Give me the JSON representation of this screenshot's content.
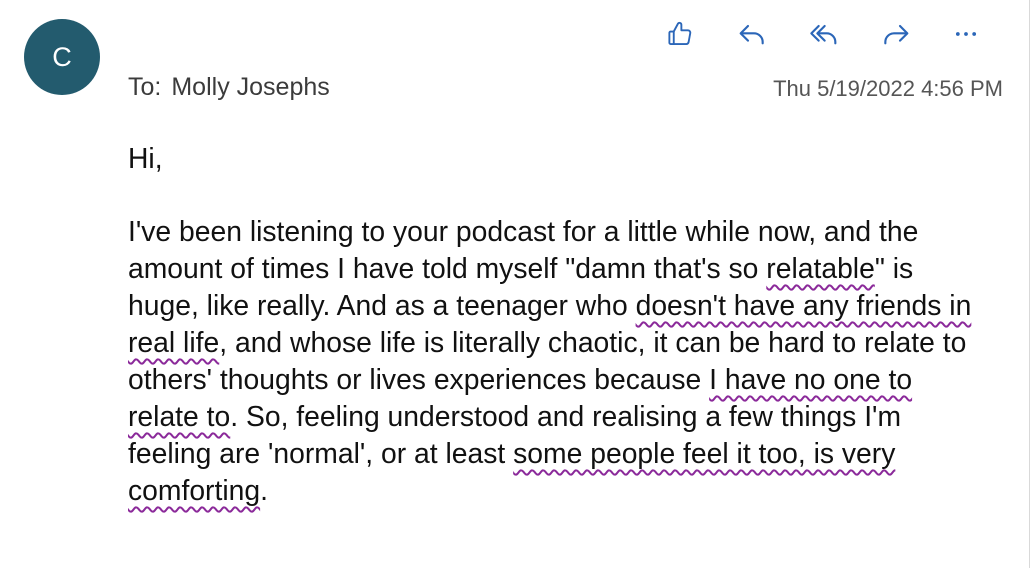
{
  "colors": {
    "avatar_bg": "#235b6e",
    "icon": "#2b66b8",
    "highlight": "#8b2a9a"
  },
  "sender": {
    "avatar_initial": "C"
  },
  "header": {
    "to_label": "To:",
    "to_name": "Molly Josephs",
    "timestamp": "Thu 5/19/2022 4:56 PM"
  },
  "actions": [
    {
      "icon": "thumbs-up-icon"
    },
    {
      "icon": "reply-icon"
    },
    {
      "icon": "reply-all-icon"
    },
    {
      "icon": "forward-icon"
    },
    {
      "icon": "more-icon"
    }
  ],
  "message": {
    "greeting": "Hi,",
    "segments": [
      {
        "text": "I've been listening to your podcast for a little while now, and the amount of times I have told myself \"damn that's so ",
        "highlight": false
      },
      {
        "text": "relatable",
        "highlight": true
      },
      {
        "text": "\" is huge, like really. And as a teenager who ",
        "highlight": false
      },
      {
        "text": "doesn't have any friends in real life",
        "highlight": true
      },
      {
        "text": ", and whose life is literally chaotic, it can be hard to relate to others' thoughts or lives experiences because ",
        "highlight": false
      },
      {
        "text": "I have no one to relate to",
        "highlight": true
      },
      {
        "text": ". So, feeling understood and realising a few things I'm feeling are 'normal', or at least ",
        "highlight": false
      },
      {
        "text": "some people feel it too, is very comforting",
        "highlight": true
      },
      {
        "text": ".",
        "highlight": false
      }
    ]
  }
}
